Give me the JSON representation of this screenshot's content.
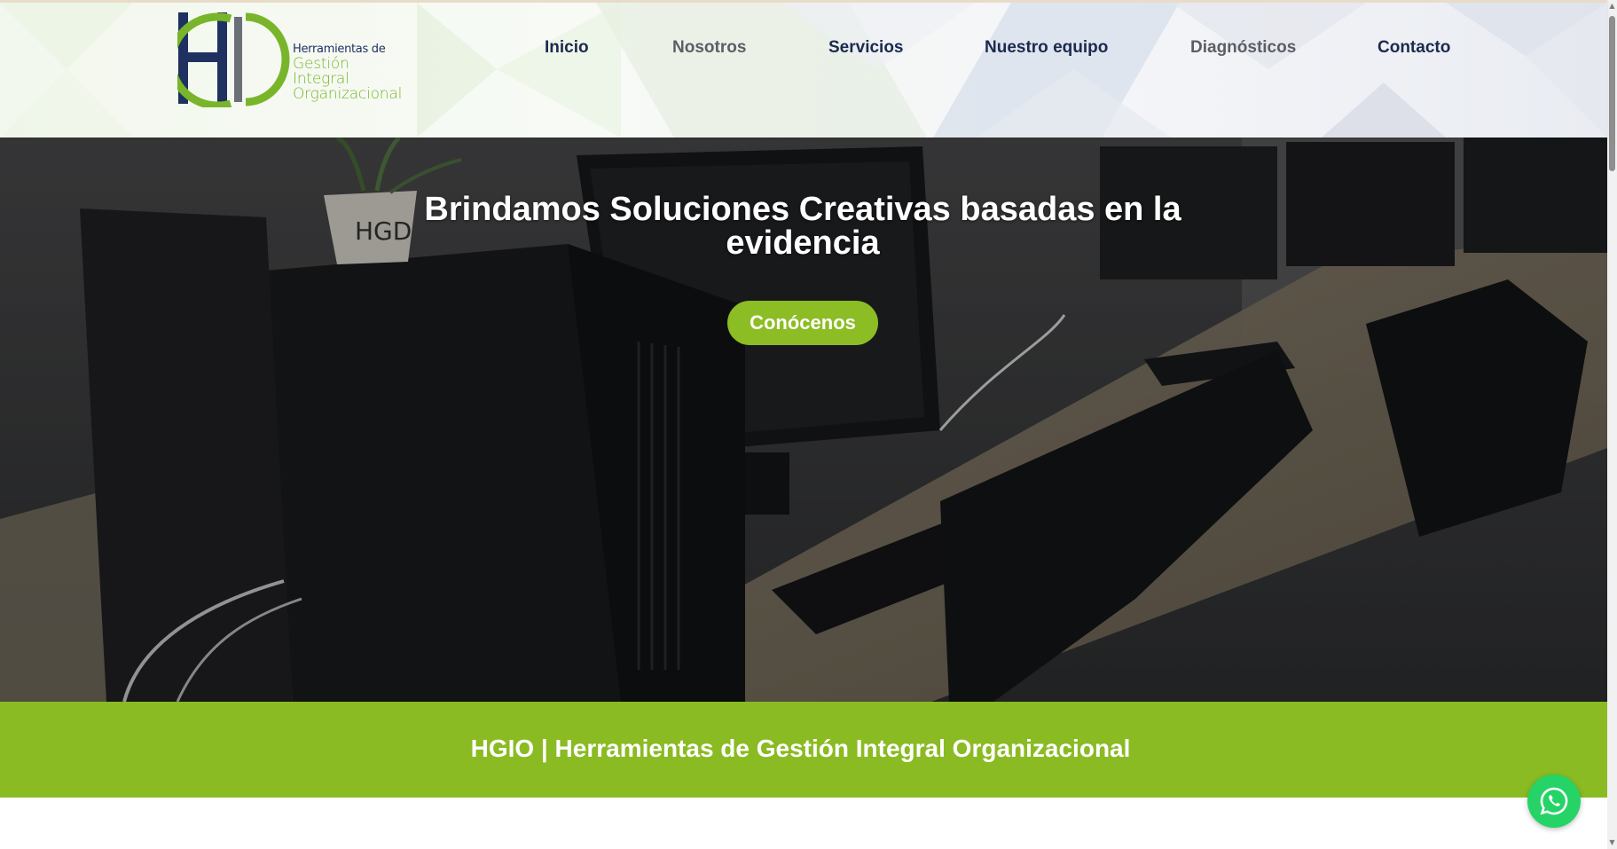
{
  "logo": {
    "mark": "HGIO",
    "line1": "Herramientas de",
    "line2": "Gestión",
    "line3": "Integral",
    "line4": "Organizacional"
  },
  "nav": {
    "items": [
      {
        "label": "Inicio"
      },
      {
        "label": "Nosotros"
      },
      {
        "label": "Servicios"
      },
      {
        "label": "Nuestro equipo"
      },
      {
        "label": "Diagnósticos"
      },
      {
        "label": "Contacto"
      }
    ]
  },
  "hero": {
    "title": "Brindamos Soluciones Creativas basadas en la evidencia",
    "button_label": "Conócenos",
    "plant_pot_mark": "HGIO"
  },
  "banner": {
    "text": "HGIO | Herramientas de Gestión Integral Organizacional"
  },
  "colors": {
    "navy": "#1b2a4e",
    "green": "#8abb23",
    "whatsapp": "#25d366"
  },
  "icons": {
    "whatsapp": "whatsapp-icon",
    "scroll_up": "scroll-up-arrow",
    "scroll_down": "scroll-down-arrow"
  }
}
